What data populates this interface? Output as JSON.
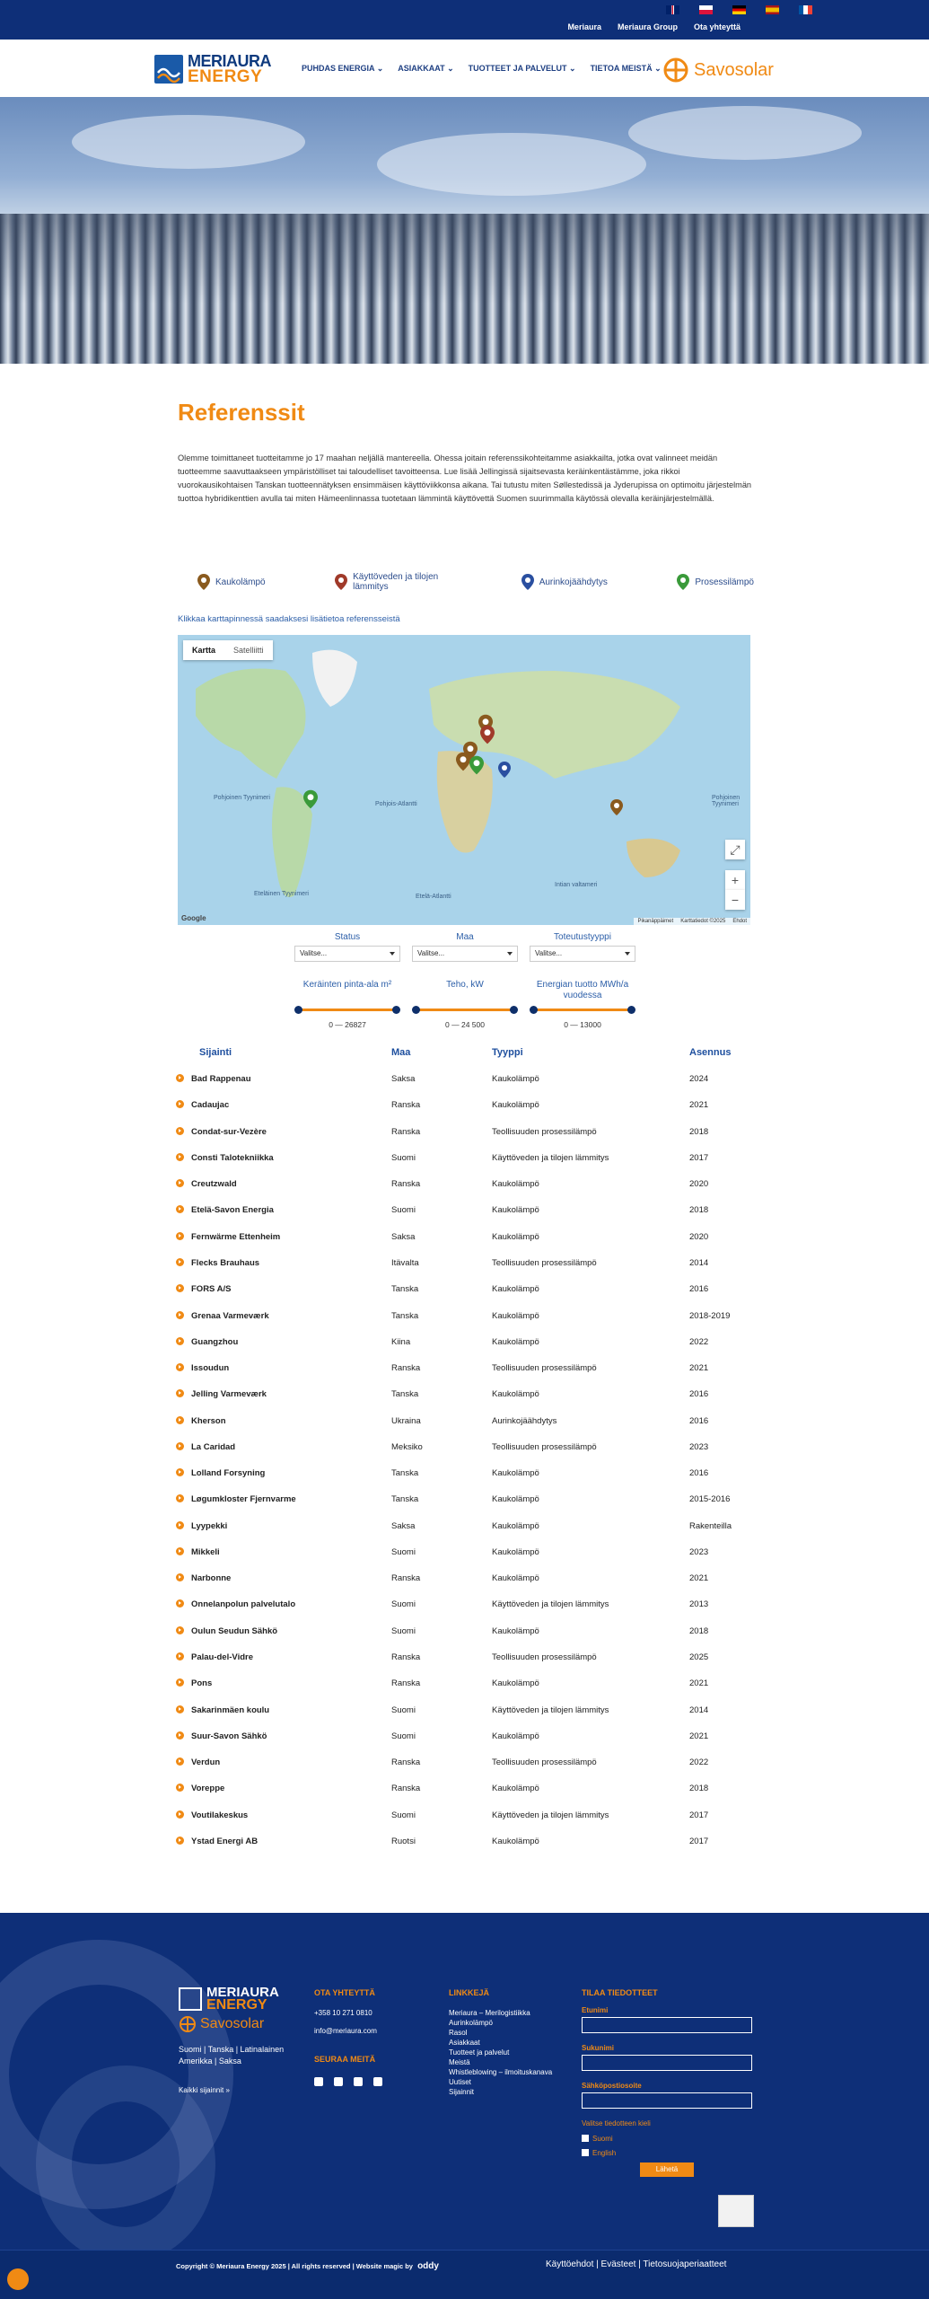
{
  "topbar": {
    "links": [
      "Meriaura",
      "Meriaura Group",
      "Ota yhteyttä"
    ],
    "flags": [
      {
        "name": "uk-flag-icon",
        "colors": [
          "#c8102e",
          "#ffffff",
          "#012169"
        ]
      },
      {
        "name": "poland-flag-icon",
        "colors": [
          "#ffffff",
          "#dc143c"
        ]
      },
      {
        "name": "germany-flag-icon",
        "colors": [
          "#000000",
          "#dd0000",
          "#ffce00"
        ]
      },
      {
        "name": "spain-flag-icon",
        "colors": [
          "#aa151b",
          "#f1bf00",
          "#aa151b"
        ]
      },
      {
        "name": "france-flag-icon",
        "colors": [
          "#0055a4",
          "#ffffff",
          "#ef4135"
        ]
      }
    ]
  },
  "logo": {
    "line1": "MERIAURA",
    "line2": "ENERGY"
  },
  "savosolar": "Savosolar",
  "menu": [
    "PUHDAS ENERGIA",
    "ASIAKKAAT",
    "TUOTTEET JA PALVELUT",
    "TIETOA MEISTÄ"
  ],
  "page": {
    "title": "Referenssit",
    "intro": "Olemme toimittaneet tuotteitamme jo 17 maahan neljällä mantereella. Ohessa joitain referenssikohteitamme asiakkailta, jotka ovat valinneet meidän tuotteemme saavuttaakseen ympäristölliset tai taloudelliset tavoitteensa. Lue lisää Jellingissä sijaitsevasta keräinkentästämme, joka rikkoi vuorokausikohtaisen Tanskan tuotteennätyksen ensimmäisen käyttöviikkonsa aikana. Tai tutustu miten Søllestedissä ja Jyderupissa on optimoitu järjestelmän tuottoa hybridikenttien avulla tai miten Hämeenlinnassa tuotetaan lämmintä käyttövettä Suomen suurimmalla käytössä olevalla keräinjärjestelmällä."
  },
  "legend": [
    {
      "label": "Kaukolämpö",
      "color": "#8a5a1e"
    },
    {
      "label": "Käyttöveden ja tilojen lämmitys",
      "color": "#a03a2a"
    },
    {
      "label": "Aurinkojäähdytys",
      "color": "#2a4fa0"
    },
    {
      "label": "Prosessilämpö",
      "color": "#3a9a3a"
    }
  ],
  "map": {
    "hint": "Klikkaa karttapinnessä saadaksesi lisätietoa referensseistä",
    "tabs": [
      "Kartta",
      "Satelliitti"
    ],
    "zoom_in": "+",
    "zoom_out": "−",
    "google": "Google",
    "footer": [
      "Pikanäppäimet",
      "Karttatiedot ©2025",
      "Ehdot"
    ],
    "labels": [
      "Pohjoinen Tyynimeri",
      "Pohjois-Atlantti",
      "Etelä-Atlantti",
      "Eteläinen Tyynimeri",
      "Intian valtameri",
      "Pohjoinen Tyynimeri"
    ]
  },
  "filters": [
    {
      "label": "Status",
      "value": "Valitse..."
    },
    {
      "label": "Maa",
      "value": "Valitse..."
    },
    {
      "label": "Toteutustyyppi",
      "value": "Valitse..."
    }
  ],
  "sliders": [
    {
      "label": "Keräinten pinta-ala m²",
      "range": "0 — 26827",
      "low": 0,
      "high": 1
    },
    {
      "label": "Teho, kW",
      "range": "0 — 24 500",
      "low": 0,
      "high": 1
    },
    {
      "label": "Energian tuotto MWh/a vuodessa",
      "range": "0 — 13000",
      "low": 0,
      "high": 1
    }
  ],
  "table": {
    "headers": [
      "Sijainti",
      "Maa",
      "Tyyppi",
      "Asennus"
    ],
    "rows": [
      [
        "Bad Rappenau",
        "Saksa",
        "Kaukolämpö",
        "2024"
      ],
      [
        "Cadaujac",
        "Ranska",
        "Kaukolämpö",
        "2021"
      ],
      [
        "Condat-sur-Vezère",
        "Ranska",
        "Teollisuuden prosessilämpö",
        "2018"
      ],
      [
        "Consti Talotekniikka",
        "Suomi",
        "Käyttöveden ja tilojen lämmitys",
        "2017"
      ],
      [
        "Creutzwald",
        "Ranska",
        "Kaukolämpö",
        "2020"
      ],
      [
        "Etelä-Savon Energia",
        "Suomi",
        "Kaukolämpö",
        "2018"
      ],
      [
        "Fernwärme Ettenheim",
        "Saksa",
        "Kaukolämpö",
        "2020"
      ],
      [
        "Flecks Brauhaus",
        "Itävalta",
        "Teollisuuden prosessilämpö",
        "2014"
      ],
      [
        "FORS A/S",
        "Tanska",
        "Kaukolämpö",
        "2016"
      ],
      [
        "Grenaa Varmeværk",
        "Tanska",
        "Kaukolämpö",
        "2018-2019"
      ],
      [
        "Guangzhou",
        "Kiina",
        "Kaukolämpö",
        "2022"
      ],
      [
        "Issoudun",
        "Ranska",
        "Teollisuuden prosessilämpö",
        "2021"
      ],
      [
        "Jelling Varmeværk",
        "Tanska",
        "Kaukolämpö",
        "2016"
      ],
      [
        "Kherson",
        "Ukraina",
        "Aurinkojäähdytys",
        "2016"
      ],
      [
        "La Caridad",
        "Meksiko",
        "Teollisuuden prosessilämpö",
        "2023"
      ],
      [
        "Lolland Forsyning",
        "Tanska",
        "Kaukolämpö",
        "2016"
      ],
      [
        "Løgumkloster Fjernvarme",
        "Tanska",
        "Kaukolämpö",
        "2015-2016"
      ],
      [
        "Lyypekki",
        "Saksa",
        "Kaukolämpö",
        "Rakenteilla"
      ],
      [
        "Mikkeli",
        "Suomi",
        "Kaukolämpö",
        "2023"
      ],
      [
        "Narbonne",
        "Ranska",
        "Kaukolämpö",
        "2021"
      ],
      [
        "Onnelanpolun palvelutalo",
        "Suomi",
        "Käyttöveden ja tilojen lämmitys",
        "2013"
      ],
      [
        "Oulun Seudun Sähkö",
        "Suomi",
        "Kaukolämpö",
        "2018"
      ],
      [
        "Palau-del-Vidre",
        "Ranska",
        "Teollisuuden prosessilämpö",
        "2025"
      ],
      [
        "Pons",
        "Ranska",
        "Kaukolämpö",
        "2021"
      ],
      [
        "Sakarinmäen koulu",
        "Suomi",
        "Käyttöveden ja tilojen lämmitys",
        "2014"
      ],
      [
        "Suur-Savon Sähkö",
        "Suomi",
        "Kaukolämpö",
        "2021"
      ],
      [
        "Verdun",
        "Ranska",
        "Teollisuuden prosessilämpö",
        "2022"
      ],
      [
        "Voreppe",
        "Ranska",
        "Kaukolämpö",
        "2018"
      ],
      [
        "Voutilakeskus",
        "Suomi",
        "Käyttöveden ja tilojen lämmitys",
        "2017"
      ],
      [
        "Ystad Energi AB",
        "Ruotsi",
        "Kaukolämpö",
        "2017"
      ]
    ]
  },
  "footer": {
    "logo_line1": "MERIAURA",
    "logo_line2": "ENERGY",
    "savosolar": "Savosolar",
    "countries": "Suomi | Tanska | Latinalainen Amerikka | Saksa",
    "all_locations": "Kaikki sijainnit »",
    "contact_title": "OTA YHTEYTTÄ",
    "phone": "+358 10 271 0810",
    "email": "info@meriaura.com",
    "follow_title": "SEURAA MEITÄ",
    "links_title": "LINKKEJÄ",
    "links": [
      "Meriaura – Merilogistiikka",
      "Aurinkolämpö",
      "Rasol",
      "Asiakkaat",
      "Tuotteet ja palvelut",
      "Meistä",
      "Whistleblowing – ilmoituskanava",
      "Uutiset",
      "Sijainnit"
    ],
    "newsletter_title": "TILAA TIEDOTTEET",
    "first_name": "Etunimi",
    "last_name": "Sukunimi",
    "email_label": "Sähköpostiosoite",
    "lang_label": "Valitse tiedotteen kieli",
    "lang_options": [
      "Suomi",
      "English"
    ],
    "submit": "Lähetä",
    "copyright": "Copyright © Meriaura Energy 2025 | All rights reserved | Website magic by",
    "agency": "oddy",
    "legal": "Käyttöehdot | Evästeet | Tietosuojaperiaatteet"
  }
}
